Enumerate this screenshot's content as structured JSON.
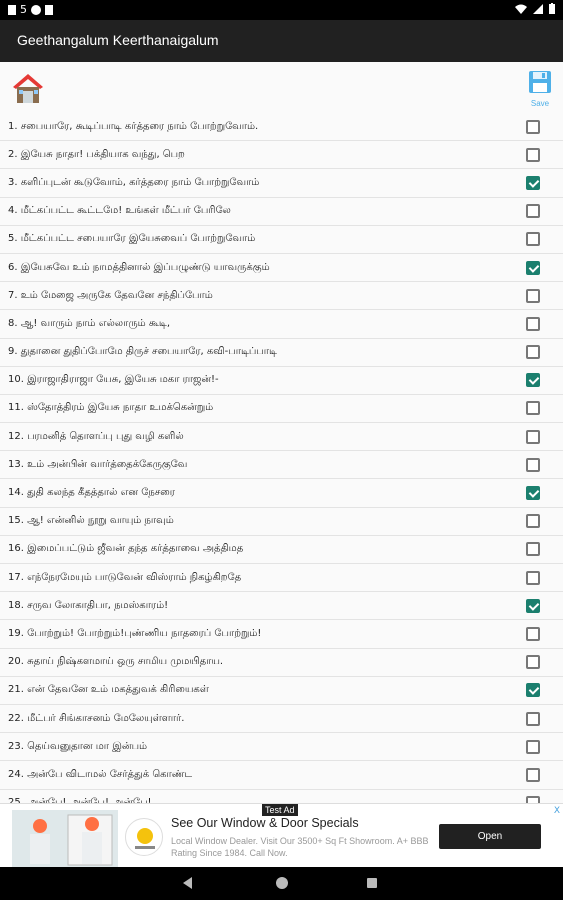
{
  "status_bar": {
    "left_icons": [
      "sd-card-icon",
      "5",
      "f-icon",
      "clipboard-icon"
    ],
    "right_icons": [
      "wifi-icon",
      "signal-icon",
      "battery-icon"
    ]
  },
  "app_bar": {
    "title": "Geethangalum Keerthanaigalum"
  },
  "toolbar": {
    "save_label": "Save",
    "home_icon": "home-icon",
    "save_icon": "floppy-disk-icon"
  },
  "songs": [
    {
      "label": "1. சபையாரே, கூடிப்பாடி கர்த்தரை நாம் போற்றுவோம்.",
      "checked": false
    },
    {
      "label": "2. இயேசு நாதா! பக்தியாக வந்து, பெற",
      "checked": false
    },
    {
      "label": "3. களிப்புடன் கூடுவோம், கர்த்தரை நாம் போற்றுவோம்",
      "checked": true
    },
    {
      "label": "4. மீட்கப்பட்ட கூட்டமே! உங்கள் மீட்பர் பேரிலே",
      "checked": false
    },
    {
      "label": "5. மீட்கப்பட்ட சபையாரே இயேசுவைப் போற்றுவோம்",
      "checked": false
    },
    {
      "label": "6. இயேசுவே உம் நாமத்தினால் இப்பழுண்டு யாவருக்கும்",
      "checked": true
    },
    {
      "label": "7. உம் மேஜை அருகே தேவனே சந்திப்போம்",
      "checked": false
    },
    {
      "label": "8. ஆ! வாரும் நாம் எல்லாரும் கூடி,",
      "checked": false
    },
    {
      "label": "9. துதானை துதிப்போமே திருச் சபையாரே, கவி-பாடிப்பாடி",
      "checked": false
    },
    {
      "label": "10. இராஜாதிராஜா யேசு, இயேசு மகா ராஜன்!-",
      "checked": true
    },
    {
      "label": "11. ஸ்தோத்திரம் இயேசு நாதா உமக்கென்றும்",
      "checked": false
    },
    {
      "label": "12. பரமனித் தொளப்பு புது வழி களில்",
      "checked": false
    },
    {
      "label": "13. உம் அன்பின் வார்த்தைக்கேருகுவே",
      "checked": false
    },
    {
      "label": "14. துதி கலந்த கீதத்தால் என நேசரை",
      "checked": true
    },
    {
      "label": "15. ஆ! என்னில் நூறு வாயும் நாவும்",
      "checked": false
    },
    {
      "label": "16. இமைப்பட்டும் ஜீவன் தந்த கர்த்தாவை அத்திமத",
      "checked": false
    },
    {
      "label": "17. எந்நேரமேயும் பாடுவேன் விஸ்ராம் நிகழ்கிறதே",
      "checked": false
    },
    {
      "label": "18. சருவ லோகாதிபா, நமஸ்காரம்!",
      "checked": true
    },
    {
      "label": "19. போற்றும்! போற்றும்!புண்ணிய நாதரைப் போற்றும்!",
      "checked": false
    },
    {
      "label": "20. சுதாய் நிஷ்களமாய் ஒரு சாமிய முமயிதாய.",
      "checked": false
    },
    {
      "label": "21. என் தேவனே உம் மகத்துவக் கிரியைகள்",
      "checked": true
    },
    {
      "label": "22. மீட்பர் சிங்காசனம் மேலேயுள்ளார்.",
      "checked": false
    },
    {
      "label": "23. தெய்வனுதான மா இன்பம்",
      "checked": false
    },
    {
      "label": "24. அன்பே விடாமல் சேர்த்துக் கொண்ட",
      "checked": false
    },
    {
      "label": "25. அன்பே! அன்பே! அன்பே!",
      "checked": false
    }
  ],
  "ad": {
    "tag": "Test Ad",
    "headline": "See Our Window & Door Specials",
    "body": "Local Window Dealer. Visit Our 3500+ Sq Ft Showroom. A+ BBB Rating Since 1984. Call Now.",
    "cta": "Open",
    "info_icon": "ad-choices-icon",
    "close_label": "X"
  },
  "colors": {
    "app_bar": "#212121",
    "checkbox_checked": "#1b7f6e",
    "save_blue": "#4fb0e8",
    "home_red": "#e53935"
  }
}
